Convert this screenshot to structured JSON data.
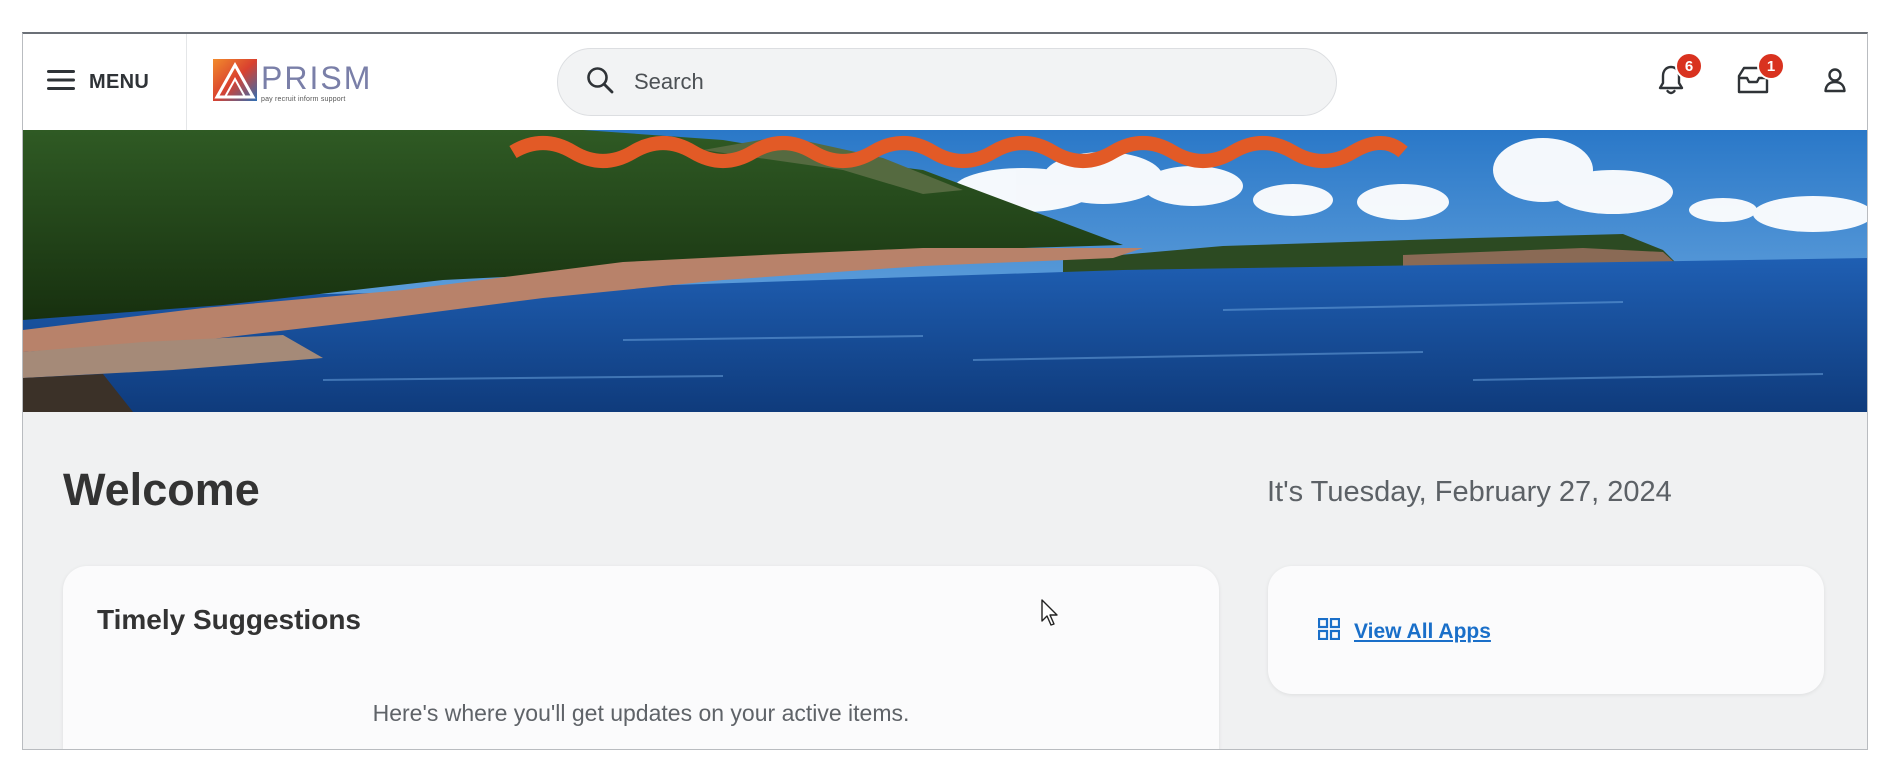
{
  "header": {
    "menu_label": "MENU",
    "logo": {
      "word": "PRISM",
      "tagline": "pay recruit inform support"
    },
    "search": {
      "placeholder": "Search",
      "value": ""
    },
    "notifications": {
      "icon": "bell-icon",
      "count": "6"
    },
    "inbox": {
      "icon": "inbox-icon",
      "count": "1"
    },
    "profile": {
      "icon": "user-icon"
    }
  },
  "banner": {
    "description_icon": "coastal-landscape-image",
    "accent_squiggle_color": "#e25a26"
  },
  "main": {
    "welcome": "Welcome",
    "date": "It's Tuesday, February 27, 2024"
  },
  "suggestions": {
    "title": "Timely Suggestions",
    "empty_message": "Here's where you'll get updates on your active items."
  },
  "apps": {
    "icon": "grid-icon",
    "link_label": "View All Apps"
  },
  "colors": {
    "badge": "#d9321f",
    "link": "#1a6fc9",
    "background": "#f0f1f2"
  }
}
